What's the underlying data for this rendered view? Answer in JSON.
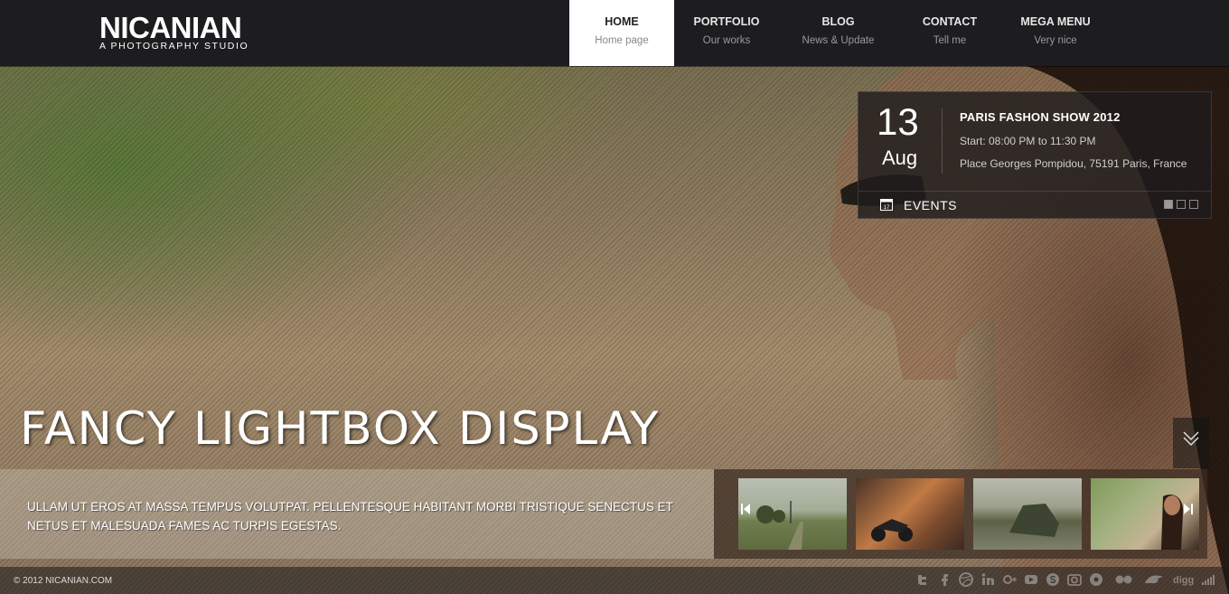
{
  "brand": {
    "title": "NICANIAN",
    "tagline": "A PHOTOGRAPHY STUDIO"
  },
  "nav": [
    {
      "label": "HOME",
      "sub": "Home page",
      "active": true
    },
    {
      "label": "PORTFOLIO",
      "sub": "Our works",
      "active": false
    },
    {
      "label": "BLOG",
      "sub": "News & Update",
      "active": false
    },
    {
      "label": "CONTACT",
      "sub": "Tell me",
      "active": false
    },
    {
      "label": "MEGA MENU",
      "sub": "Very nice",
      "active": false
    }
  ],
  "event": {
    "day": "13",
    "month": "Aug",
    "title": "PARIS FASHON SHOW 2012",
    "time": "Start: 08:00 PM to 11:30 PM",
    "place": "Place Georges Pompidou, 75191 Paris, France",
    "section_label": "EVENTS",
    "icon": "calendar-icon",
    "pages": 3,
    "current_page": 1
  },
  "hero": {
    "headline": "FANCY LIGHTBOX DISPLAY",
    "caption": "ULLAM UT EROS AT MASSA TEMPUS VOLUTPAT. PELLENTESQUE HABITANT MORBI TRISTIQUE SENECTUS ET NETUS ET MALESUADA FAMES AC TURPIS EGESTAS."
  },
  "thumbnails": [
    "countryside-road",
    "scooter-street",
    "coastal-rock",
    "woman-portrait"
  ],
  "footer": {
    "copyright": "© 2012 NICANIAN.COM",
    "socials": [
      "twitter-icon",
      "facebook-icon",
      "dribbble-icon",
      "linkedin-icon",
      "google-plus-icon",
      "youtube-icon",
      "skype-icon",
      "instagram-icon",
      "picasa-icon",
      "flickr-icon",
      "deviantart-icon",
      "digg-icon",
      "signal-icon"
    ]
  },
  "colors": {
    "header_bg": "#1d1d20",
    "active_nav_bg": "#ffffff",
    "text_light": "#ffffff"
  }
}
